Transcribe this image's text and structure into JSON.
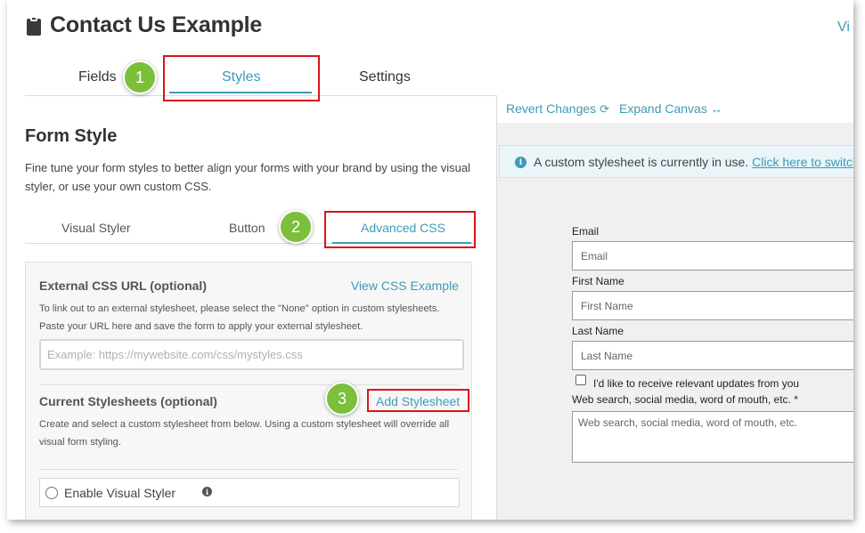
{
  "header": {
    "title": "Contact Us Example",
    "top_right_link": "Vi"
  },
  "main_tabs": [
    {
      "label": "Fields"
    },
    {
      "label": "Styles"
    },
    {
      "label": "Settings"
    }
  ],
  "badges": [
    "1",
    "2",
    "3"
  ],
  "form_style": {
    "title": "Form Style",
    "description": "Fine tune your form styles to better align your forms with your brand by using the visual styler, or use your own custom CSS."
  },
  "sub_tabs": [
    {
      "label": "Visual Styler"
    },
    {
      "label": "Button"
    },
    {
      "label": "Advanced CSS"
    }
  ],
  "advanced_css": {
    "external_label": "External CSS URL (optional)",
    "view_example_link": "View CSS Example",
    "external_help": "To link out to an external stylesheet, please select the \"None\" option in custom stylesheets. Paste your URL here and save the form to apply your external stylesheet.",
    "external_placeholder": "Example: https://mywebsite.com/css/mystyles.css",
    "current_label": "Current Stylesheets (optional)",
    "add_stylesheet_link": "Add Stylesheet",
    "current_help": "Create and select a custom stylesheet from below. Using a custom stylesheet will override all visual form styling.",
    "enable_visual_styler_label": "Enable Visual Styler"
  },
  "canvas": {
    "revert_label": "Revert Changes",
    "expand_label": "Expand Canvas",
    "notice_text": "A custom stylesheet is currently in use.",
    "notice_link": "Click here to switch"
  },
  "preview_form": {
    "email_label": "Email",
    "email_placeholder": "Email",
    "first_name_label": "First Name",
    "first_name_placeholder": "First Name",
    "last_name_label": "Last Name",
    "last_name_placeholder": "Last Name",
    "updates_checkbox_label": "I'd like to receive relevant updates from you",
    "source_label": "Web search, social media, word of mouth, etc. *",
    "source_placeholder": "Web search, social media, word of mouth, etc."
  },
  "colors": {
    "accent": "#3d9bb7",
    "highlight_red": "#d9141a",
    "badge_green": "#7bbf3a"
  }
}
